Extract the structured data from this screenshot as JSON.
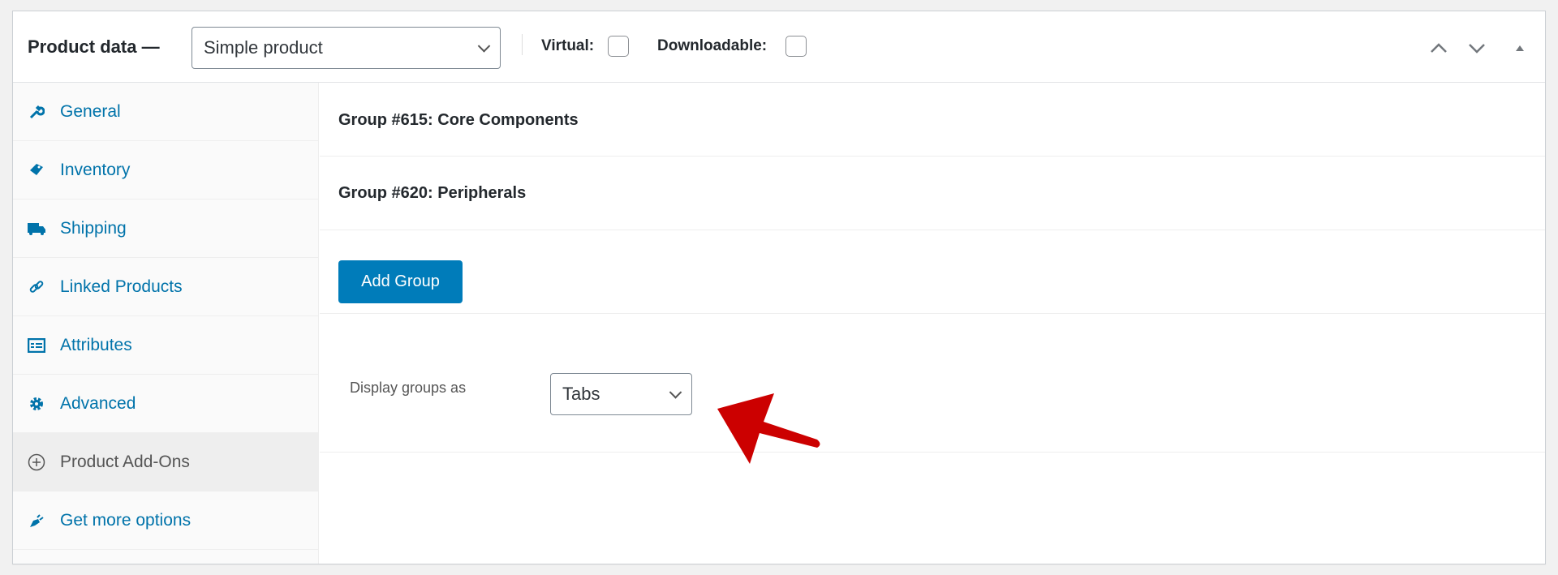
{
  "header": {
    "title": "Product data —",
    "product_type": "Simple product",
    "virtual_label": "Virtual:",
    "virtual_checked": false,
    "downloadable_label": "Downloadable:",
    "downloadable_checked": false
  },
  "sidebar": {
    "items": [
      {
        "label": "General",
        "icon": "wrench-icon"
      },
      {
        "label": "Inventory",
        "icon": "tag-icon"
      },
      {
        "label": "Shipping",
        "icon": "truck-icon"
      },
      {
        "label": "Linked Products",
        "icon": "link-icon"
      },
      {
        "label": "Attributes",
        "icon": "list-icon"
      },
      {
        "label": "Advanced",
        "icon": "gear-icon"
      },
      {
        "label": "Product Add-Ons",
        "icon": "plus-circle-icon",
        "active": true
      },
      {
        "label": "Get more options",
        "icon": "plug-icon"
      }
    ]
  },
  "main": {
    "groups": [
      "Group #615: Core Components",
      "Group #620: Peripherals"
    ],
    "add_group_label": "Add Group",
    "display_label": "Display groups as",
    "display_value": "Tabs"
  },
  "colors": {
    "accent": "#007cba",
    "link": "#0073aa",
    "annotation_arrow": "#cc0000"
  }
}
